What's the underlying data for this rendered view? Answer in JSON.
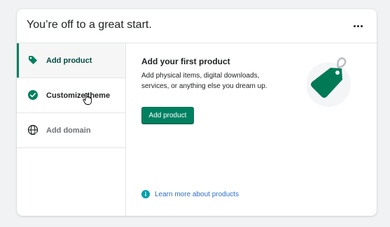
{
  "header": {
    "title": "You’re off to a great start.",
    "menu_icon": "horizontal-dots-icon"
  },
  "steps": [
    {
      "label": "Add product",
      "icon": "tag-icon",
      "state": "active"
    },
    {
      "label": "Customize theme",
      "icon": "checkmark-circle-icon",
      "state": "completed"
    },
    {
      "label": "Add domain",
      "icon": "globe-icon",
      "state": "pending"
    }
  ],
  "panel": {
    "title": "Add your first product",
    "description": "Add physical items, digital downloads, services, or anything else you dream up.",
    "button_label": "Add product",
    "illustration": "price-tag-illustration",
    "learn_more_label": "Learn more about products",
    "learn_more_icon": "info-circle-icon"
  },
  "colors": {
    "accent": "#008060",
    "link": "#2c6ecb",
    "tag_green": "#007a55"
  }
}
